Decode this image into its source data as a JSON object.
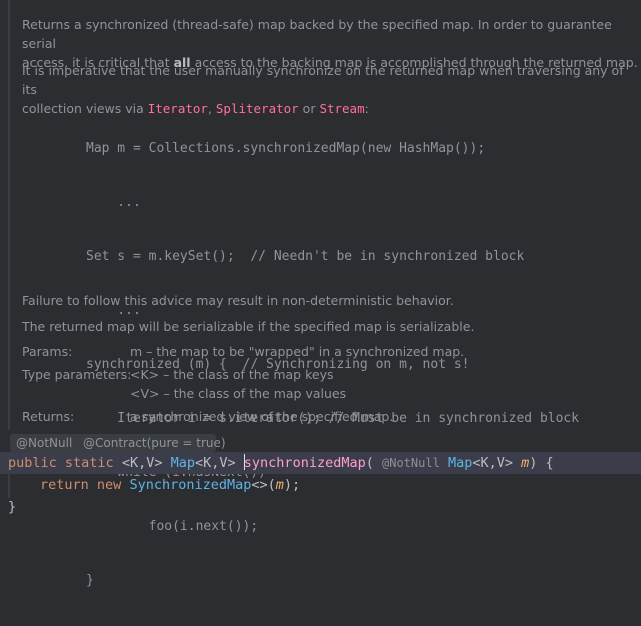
{
  "doc": {
    "p1_line1": "Returns a synchronized (thread-safe) map backed by the specified map. In order to guarantee serial",
    "p1_line2_a": "access, it is critical that ",
    "p1_line2_bold": "all",
    "p1_line2_b": " access to the backing map is accomplished through the returned map.",
    "p2_line1": "It is imperative that the user manually synchronize on the returned map when traversing any of its",
    "p2_line2_a": "collection views via ",
    "link_iterator": "Iterator",
    "sep1": ", ",
    "link_spliterator": "Spliterator",
    "sep2": " or ",
    "link_stream": "Stream",
    "end_colon": ":",
    "code_lines": [
      "Map m = Collections.synchronizedMap(new HashMap());",
      "    ...",
      "Set s = m.keySet();  // Needn't be in synchronized block",
      "    ...",
      "synchronized (m) {  // Synchronizing on m, not s!",
      "    Iterator i = s.iterator(); // Must be in synchronized block",
      "    while (i.hasNext())",
      "        foo(i.next());",
      "}"
    ],
    "p3": "Failure to follow this advice may result in non-deterministic behavior.",
    "p4": "The returned map will be serializable if the specified map is serializable.",
    "params_label": "Params:",
    "params_value": "m – the map to be \"wrapped\" in a synchronized map.",
    "type_params_label": "Type parameters:",
    "type_param_k": "<K> – the class of the map keys",
    "type_param_v": "<V> – the class of the map values",
    "returns_label": "Returns:",
    "returns_value": "a synchronized view of the specified map."
  },
  "annotations": {
    "notnull": "@NotNull",
    "contract": "@Contract(pure = true)"
  },
  "signature": {
    "kw_public": "public",
    "kw_static": "static",
    "generics": "<K,V>",
    "ret_type": "Map",
    "ret_generics": "<K,V>",
    "method_name": "synchronizedMap",
    "open_paren": "(",
    "param_anno": "@NotNull",
    "param_type": "Map",
    "param_generics": "<K,V>",
    "param_name": "m",
    "close": ") {"
  },
  "body": {
    "kw_return": "return",
    "kw_new": "new",
    "class_name": "SynchronizedMap",
    "diamond": "<>(",
    "arg": "m",
    "end": ");",
    "closing_brace": "}"
  },
  "colors": {
    "background": "#2b2d30",
    "highlight_line": "#3b3d4a",
    "keyword": "#cf8e6d",
    "type": "#5fb3e6",
    "method": "#ff9fd0",
    "param": "#f0b26b",
    "link": "#ff6f9f"
  }
}
